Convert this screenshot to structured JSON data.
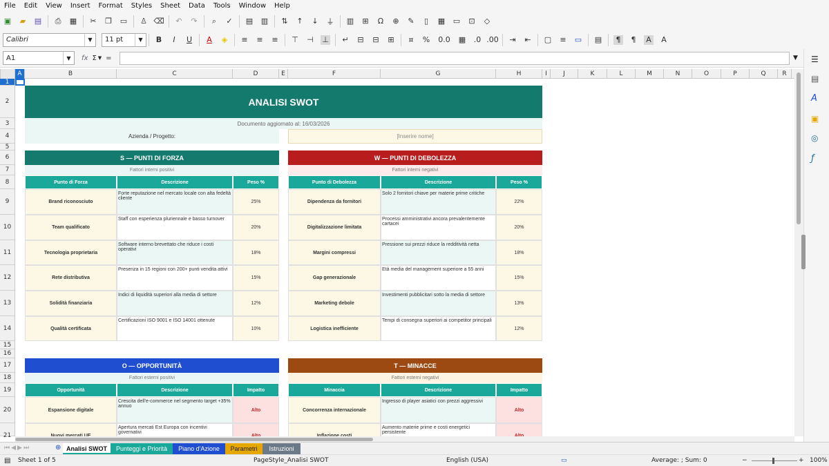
{
  "menu": [
    "File",
    "Edit",
    "View",
    "Insert",
    "Format",
    "Styles",
    "Sheet",
    "Data",
    "Tools",
    "Window",
    "Help"
  ],
  "toolbar": {
    "font_name": "Calibri",
    "font_size": "11 pt",
    "bold": "B",
    "italic": "I",
    "underline": "U",
    "percent": "%",
    "decimal": "0.0"
  },
  "formula_bar": {
    "cell_ref": "A1",
    "fx": "fx",
    "sigma": "Σ",
    "equals": "=",
    "content": ""
  },
  "columns": [
    "A",
    "B",
    "C",
    "D",
    "E",
    "F",
    "G",
    "H",
    "I",
    "J",
    "K",
    "L",
    "M",
    "N",
    "O",
    "P",
    "Q",
    "R"
  ],
  "rows": [
    "1",
    "2",
    "3",
    "4",
    "5",
    "6",
    "7",
    "8",
    "9",
    "10",
    "11",
    "12",
    "13",
    "14",
    "15",
    "16",
    "17",
    "18",
    "19",
    "20",
    "21"
  ],
  "sheet": {
    "title": "ANALISI SWOT",
    "doc_updated": "Documento aggiornato al: 16/03/2026",
    "company_label": "Azienda / Progetto:",
    "company_value": "[Inserire nome]",
    "strengths": {
      "header": "S — PUNTI DI FORZA",
      "sub": "Fattori interni positivi",
      "cols": [
        "Punto di Forza",
        "Descrizione",
        "Peso %"
      ],
      "rows": [
        [
          "Brand riconosciuto",
          "Forte reputazione nel mercato locale con alta fedeltà cliente",
          "25%"
        ],
        [
          "Team qualificato",
          "Staff con esperienza pluriennale e basso turnover",
          "20%"
        ],
        [
          "Tecnologia proprietaria",
          "Software interno brevettato che riduce i costi operativi",
          "18%"
        ],
        [
          "Rete distributiva",
          "Presenza in 15 regioni con 200+ punti vendita attivi",
          "15%"
        ],
        [
          "Solidità finanziaria",
          "Indici di liquidità superiori alla media di settore",
          "12%"
        ],
        [
          "Qualità certificata",
          "Certificazioni ISO 9001 e ISO 14001 ottenute",
          "10%"
        ]
      ]
    },
    "weaknesses": {
      "header": "W — PUNTI DI DEBOLEZZA",
      "sub": "Fattori interni negativi",
      "cols": [
        "Punto di Debolezza",
        "Descrizione",
        "Peso %"
      ],
      "rows": [
        [
          "Dipendenza da fornitori",
          "Solo 2 fornitori chiave per materie prime critiche",
          "22%"
        ],
        [
          "Digitalizzazione limitata",
          "Processi amministrativi ancora prevalentemente cartacei",
          "20%"
        ],
        [
          "Margini compressi",
          "Pressione sui prezzi riduce la redditività netta",
          "18%"
        ],
        [
          "Gap generazionale",
          "Età media del management superiore a 55 anni",
          "15%"
        ],
        [
          "Marketing debole",
          "Investimenti pubblicitari sotto la media di settore",
          "13%"
        ],
        [
          "Logistica inefficiente",
          "Tempi di consegna superiori ai competitor principali",
          "12%"
        ]
      ]
    },
    "opportunities": {
      "header": "O — OPPORTUNITÀ",
      "sub": "Fattori esterni positivi",
      "cols": [
        "Opportunità",
        "Descrizione",
        "Impatto"
      ],
      "rows": [
        [
          "Espansione digitale",
          "Crescita dell'e-commerce nel segmento target +35% annuo",
          "Alto"
        ],
        [
          "Nuovi mercati UE",
          "Apertura mercati Est Europa con incentivi governativi",
          "Alto"
        ]
      ]
    },
    "threats": {
      "header": "T — MINACCE",
      "sub": "Fattori esterni negativi",
      "cols": [
        "Minaccia",
        "Descrizione",
        "Impatto"
      ],
      "rows": [
        [
          "Concorrenza internazionale",
          "Ingresso di player asiatici con prezzi aggressivi",
          "Alto"
        ],
        [
          "Inflazione costi",
          "Aumento materie prime e costi energetici persistente",
          "Alto"
        ]
      ]
    }
  },
  "tabs": [
    {
      "label": "Analisi SWOT",
      "color": "#ffffff"
    },
    {
      "label": "Punteggi e Priorità",
      "color": "#1aa89a"
    },
    {
      "label": "Piano d'Azione",
      "color": "#1f4fd0"
    },
    {
      "label": "Parametri",
      "color": "#e6a800"
    },
    {
      "label": "Istruzioni",
      "color": "#6b7a86"
    }
  ],
  "status": {
    "sheet": "Sheet 1 of 5",
    "page_style": "PageStyle_Analisi SWOT",
    "language": "English (USA)",
    "sum": "Average: ; Sum: 0",
    "zoom": "100%"
  },
  "colors": {
    "teal_dark": "#137a6d",
    "teal": "#1aa89a",
    "red": "#b81c1c",
    "blue": "#1f4fd0",
    "brown": "#9c4a11",
    "cream": "#fdf8e6",
    "light_teal": "#ebf7f5",
    "high_bg": "#fde0e0",
    "high_text": "#c62828"
  }
}
